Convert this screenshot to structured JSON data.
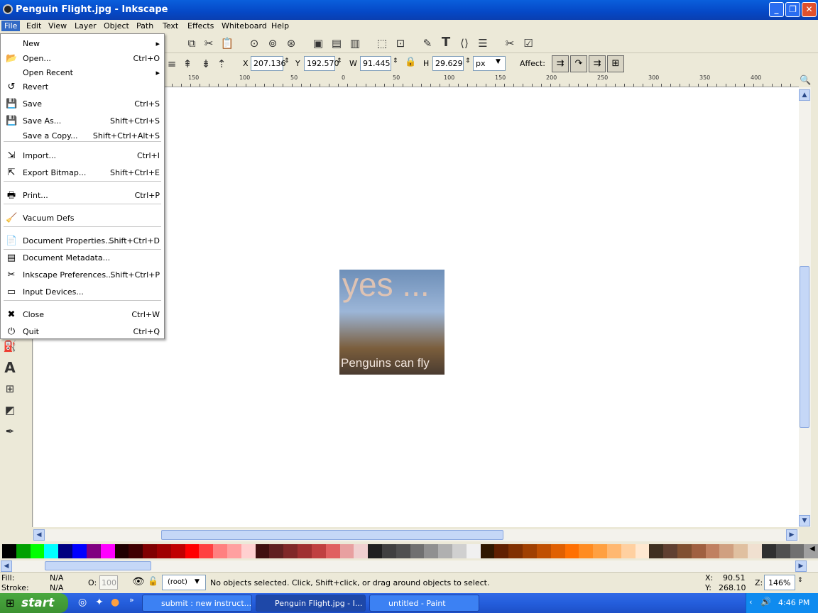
{
  "window": {
    "title": "Penguin Flight.jpg - Inkscape",
    "minimize": "_",
    "restore": "❐",
    "close": "✕"
  },
  "menubar": [
    {
      "label": "File"
    },
    {
      "label": "Edit"
    },
    {
      "label": "View"
    },
    {
      "label": "Layer"
    },
    {
      "label": "Object"
    },
    {
      "label": "Path"
    },
    {
      "label": "Text"
    },
    {
      "label": "Effects"
    },
    {
      "label": "Whiteboard"
    },
    {
      "label": "Help"
    }
  ],
  "filemenu": [
    {
      "label": "New",
      "accel": "",
      "icon": "",
      "sub": true
    },
    {
      "label": "Open...",
      "accel": "Ctrl+O",
      "icon": "open-folder-icon"
    },
    {
      "label": "Open Recent",
      "accel": "",
      "icon": "",
      "sub": true
    },
    {
      "label": "Revert",
      "accel": "",
      "icon": "revert-icon"
    },
    {
      "label": "Save",
      "accel": "Ctrl+S",
      "icon": "save-icon"
    },
    {
      "label": "Save As...",
      "accel": "Shift+Ctrl+S",
      "icon": "save-as-icon"
    },
    {
      "label": "Save a Copy...",
      "accel": "Shift+Ctrl+Alt+S",
      "icon": ""
    },
    {
      "label": "Import...",
      "accel": "Ctrl+I",
      "icon": "import-icon"
    },
    {
      "label": "Export Bitmap...",
      "accel": "Shift+Ctrl+E",
      "icon": "export-icon"
    },
    {
      "label": "Print...",
      "accel": "Ctrl+P",
      "icon": "printer-icon"
    },
    {
      "label": "Vacuum Defs",
      "accel": "",
      "icon": "vacuum-icon"
    },
    {
      "label": "Document Properties...",
      "accel": "Shift+Ctrl+D",
      "icon": "document-properties-icon"
    },
    {
      "label": "Document Metadata...",
      "accel": "",
      "icon": "metadata-icon"
    },
    {
      "label": "Inkscape Preferences...",
      "accel": "Shift+Ctrl+P",
      "icon": "preferences-icon"
    },
    {
      "label": "Input Devices...",
      "accel": "",
      "icon": "input-devices-icon"
    },
    {
      "label": "Close",
      "accel": "Ctrl+W",
      "icon": "close-icon"
    },
    {
      "label": "Quit",
      "accel": "Ctrl+Q",
      "icon": "quit-icon"
    }
  ],
  "controls": {
    "x_label": "X",
    "x_value": "207.136",
    "y_label": "Y",
    "y_value": "192.570",
    "w_label": "W",
    "w_value": "91.445",
    "h_label": "H",
    "h_value": "29.629",
    "unit": "px",
    "affect_label": "Affect:"
  },
  "ruler": {
    "ticks": [
      "150",
      "100",
      "50",
      "0",
      "50",
      "100",
      "150",
      "200",
      "250",
      "300",
      "350",
      "400"
    ]
  },
  "artwork": {
    "headline": "yes ...",
    "caption": "Penguins can fly"
  },
  "palette": [
    "#000000",
    "#00a000",
    "#00ff00",
    "#00ffff",
    "#000080",
    "#0000ff",
    "#800080",
    "#ff00ff",
    "#200000",
    "#400000",
    "#800000",
    "#a00000",
    "#c00000",
    "#ff0000",
    "#ff4040",
    "#ff8080",
    "#ffa0a0",
    "#ffd0d0",
    "#401010",
    "#602020",
    "#802828",
    "#a03030",
    "#c04040",
    "#e06060",
    "#e8a0a0",
    "#f0d0d0",
    "#202020",
    "#404040",
    "#505050",
    "#707070",
    "#909090",
    "#b0b0b0",
    "#d0d0d0",
    "#f0f0f0",
    "#301800",
    "#602000",
    "#803000",
    "#a04000",
    "#c05000",
    "#e06000",
    "#ff7000",
    "#ff8c20",
    "#ffa040",
    "#ffb870",
    "#ffd0a0",
    "#ffe8d0",
    "#403020",
    "#604030",
    "#805030",
    "#a06040",
    "#c08060",
    "#d0a080",
    "#e0c0a0",
    "#f0e0d0",
    "#303030",
    "#505050",
    "#707070",
    "#a0a0a0"
  ],
  "status": {
    "fill_label": "Fill:",
    "fill_value": "N/A",
    "stroke_label": "Stroke:",
    "stroke_value": "N/A",
    "opacity_label": "O:",
    "opacity_value": "100",
    "layer": "(root)",
    "message": "No objects selected. Click, Shift+click, or drag around objects to select.",
    "x_label": "X:",
    "x_value": "90.51",
    "y_label": "Y:",
    "y_value": "268.10",
    "zoom_label": "Z:",
    "zoom_value": "146%"
  },
  "taskbar": {
    "start": "start",
    "tasks": [
      {
        "label": "submit : new instruct..."
      },
      {
        "label": "Penguin Flight.jpg - I..."
      },
      {
        "label": "untitled - Paint"
      }
    ],
    "clock": "4:46 PM"
  }
}
